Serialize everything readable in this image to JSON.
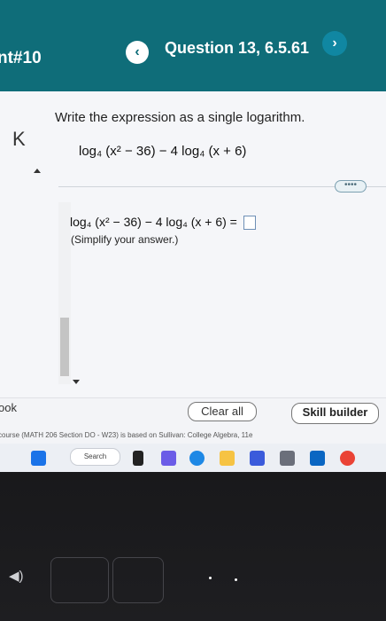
{
  "header": {
    "left_text": "nt#10",
    "question_title": "Question 13, 6.5.61",
    "prev_symbol": "‹",
    "next_symbol": "›"
  },
  "question": {
    "first_symbol": "K",
    "prompt": "Write the expression as a single logarithm.",
    "expression": "log₄ (x² − 36) − 4 log₄ (x + 6)",
    "answer_expression": "log₄ (x² − 36) − 4 log₄ (x + 6) =",
    "hint": "(Simplify your answer.)",
    "more_label": "••••"
  },
  "footer": {
    "book_label": "ook",
    "clear_all": "Clear all",
    "skill_builder": "Skill builder",
    "course_line": "course (MATH 206 Section DO - W23) is based on Sullivan: College Algebra, 11e"
  },
  "taskbar": {
    "search_label": "Search"
  }
}
